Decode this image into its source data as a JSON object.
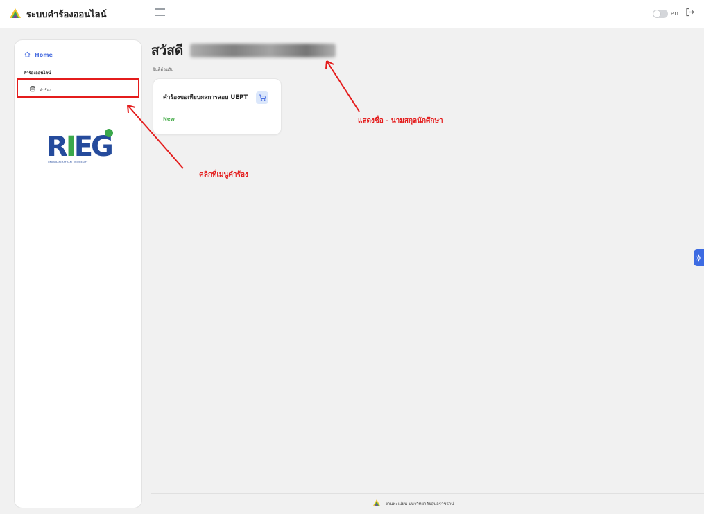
{
  "header": {
    "app_title": "ระบบคำร้องออนไลน์",
    "lang_label": "en",
    "icons": [
      "mountain-logo-icon",
      "hamburger-menu-icon",
      "theme-toggle",
      "logout-icon"
    ]
  },
  "sidebar": {
    "home_label": "Home",
    "section_title": "คำร้องออนไลน์",
    "request_label": "คำร้อง",
    "logo_letters": [
      "R",
      "I",
      "E",
      "G"
    ],
    "logo_subtext": "UBON RATCHATHANI UNIVERSITY"
  },
  "main": {
    "greeting_prefix": "สวัสดี",
    "welcome_text": "ยินดีต้อนรับ",
    "card": {
      "title": "คำร้องขอเทียบผลการสอบ UEPT",
      "status": "New"
    }
  },
  "annotations": {
    "name_note": "แสดงชื่อ - นามสกุลนักศึกษา",
    "click_note": "คลิกที่เมนูคำร้อง",
    "color": "#e41c1c"
  },
  "footer": {
    "text": "งานทะเบียน มหาวิทยาลัยอุบลราชธานี"
  },
  "colors": {
    "accent": "#4a6ee0",
    "status_new": "#4caf50",
    "logo_blue": "#254b9c",
    "logo_green": "#3ba84b"
  }
}
